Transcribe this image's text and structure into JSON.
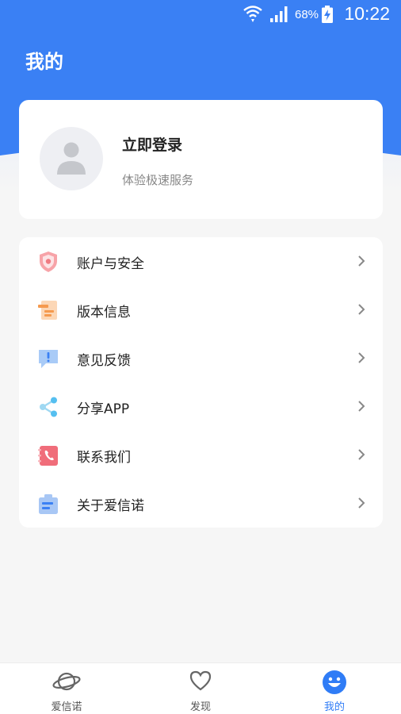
{
  "status_bar": {
    "battery_percent": "68%",
    "time": "10:22"
  },
  "header": {
    "title": "我的",
    "brand_color": "#3a80f4"
  },
  "profile": {
    "login_title": "立即登录",
    "login_subtitle": "体验极速服务"
  },
  "menu": {
    "items": [
      {
        "label": "账户与安全",
        "icon": "shield-icon"
      },
      {
        "label": "版本信息",
        "icon": "document-icon"
      },
      {
        "label": "意见反馈",
        "icon": "feedback-icon"
      },
      {
        "label": "分享APP",
        "icon": "share-icon"
      },
      {
        "label": "联系我们",
        "icon": "phone-icon"
      },
      {
        "label": "关于爱信诺",
        "icon": "briefcase-icon"
      }
    ]
  },
  "bottom_nav": {
    "tabs": [
      {
        "label": "爱信诺",
        "icon": "planet-icon"
      },
      {
        "label": "发现",
        "icon": "heart-icon"
      },
      {
        "label": "我的",
        "icon": "smiley-icon",
        "active": true
      }
    ]
  }
}
